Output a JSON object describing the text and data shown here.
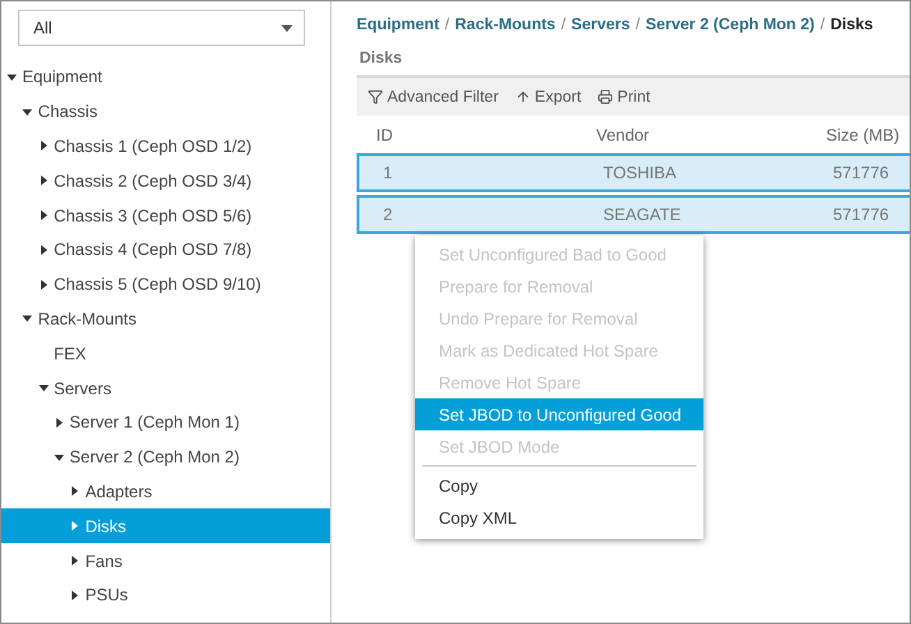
{
  "filter_select": {
    "value": "All"
  },
  "tree": [
    {
      "label": "Equipment",
      "expanded": true,
      "selected": false,
      "children": [
        {
          "label": "Chassis",
          "expanded": true,
          "selected": false,
          "children": [
            {
              "label": "Chassis 1 (Ceph OSD 1/2)",
              "expanded": false,
              "selected": false
            },
            {
              "label": "Chassis 2 (Ceph OSD 3/4)",
              "expanded": false,
              "selected": false
            },
            {
              "label": "Chassis 3 (Ceph OSD 5/6)",
              "expanded": false,
              "selected": false
            },
            {
              "label": "Chassis 4 (Ceph OSD 7/8)",
              "expanded": false,
              "selected": false
            },
            {
              "label": "Chassis 5 (Ceph OSD 9/10)",
              "expanded": false,
              "selected": false
            }
          ]
        },
        {
          "label": "Rack-Mounts",
          "expanded": true,
          "selected": false,
          "children": [
            {
              "label": "FEX",
              "selected": false
            },
            {
              "label": "Servers",
              "expanded": true,
              "selected": false,
              "children": [
                {
                  "label": "Server 1 (Ceph Mon 1)",
                  "expanded": false,
                  "selected": false
                },
                {
                  "label": "Server 2 (Ceph Mon 2)",
                  "expanded": true,
                  "selected": false,
                  "children": [
                    {
                      "label": "Adapters",
                      "expanded": false,
                      "selected": false
                    },
                    {
                      "label": "Disks",
                      "expanded": false,
                      "selected": true
                    },
                    {
                      "label": "Fans",
                      "expanded": false,
                      "selected": false
                    },
                    {
                      "label": "PSUs",
                      "expanded": false,
                      "selected": false
                    }
                  ]
                }
              ]
            }
          ]
        }
      ]
    }
  ],
  "breadcrumb": [
    {
      "kind": "link",
      "text": "Equipment"
    },
    {
      "kind": "separator",
      "text": "/"
    },
    {
      "kind": "link",
      "text": "Rack-Mounts"
    },
    {
      "kind": "separator",
      "text": "/"
    },
    {
      "kind": "link",
      "text": "Servers"
    },
    {
      "kind": "separator",
      "text": "/"
    },
    {
      "kind": "link",
      "text": "Server 2 (Ceph Mon 2)"
    },
    {
      "kind": "separator",
      "text": "/"
    },
    {
      "kind": "current",
      "text": "Disks"
    }
  ],
  "section_title": "Disks",
  "toolbar": [
    {
      "label": "Advanced Filter"
    },
    {
      "label": "Export"
    },
    {
      "label": "Print"
    }
  ],
  "table": {
    "columns": [
      "ID",
      "Vendor",
      "Size (MB)"
    ],
    "rows": [
      {
        "cells": [
          "1",
          "TOSHIBA",
          "571776"
        ],
        "selected": true
      },
      {
        "cells": [
          "2",
          "SEAGATE",
          "571776"
        ],
        "selected": true
      }
    ]
  },
  "context_menu": {
    "groups": [
      [
        {
          "label": "Set Unconfigured Bad to Good",
          "disabled": true,
          "selected": false
        },
        {
          "label": "Prepare for Removal",
          "disabled": true,
          "selected": false
        },
        {
          "label": "Undo Prepare for Removal",
          "disabled": true,
          "selected": false
        },
        {
          "label": "Mark as Dedicated Hot Spare",
          "disabled": true,
          "selected": false
        },
        {
          "label": "Remove Hot Spare",
          "disabled": true,
          "selected": false
        },
        {
          "label": "Set JBOD to Unconfigured Good",
          "disabled": false,
          "selected": true
        },
        {
          "label": "Set JBOD Mode",
          "disabled": true,
          "selected": false
        }
      ],
      [
        {
          "label": "Copy",
          "disabled": false,
          "selected": false
        },
        {
          "label": "Copy XML",
          "disabled": false,
          "selected": false
        }
      ]
    ]
  }
}
